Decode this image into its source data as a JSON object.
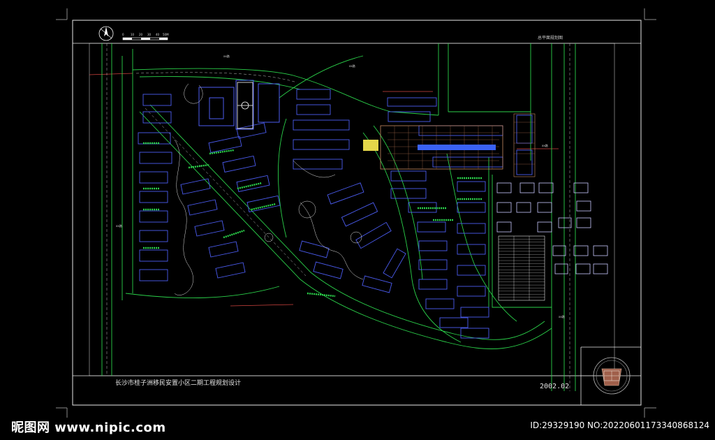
{
  "drawing": {
    "title_top": "总平面规划图",
    "title_bottom": "长沙市桂子洲移民安置小区二期工程规划设计",
    "date": "2002.02",
    "scale_ticks": [
      "0",
      "10",
      "20",
      "30",
      "40",
      "50M"
    ],
    "road_labels": [
      "xx路",
      "xx路",
      "xx路",
      "xx路",
      "xx路"
    ],
    "table_rows": [
      "",
      "",
      "",
      "",
      "",
      "",
      "",
      "",
      "",
      "",
      "",
      "",
      "",
      "",
      "",
      "",
      "",
      "",
      "",
      "",
      ""
    ],
    "colors": {
      "background": "#000000",
      "road": "#2bd14a",
      "building": "#4b5cf0",
      "boundary": "#ffffff",
      "accent_red": "#d0443f",
      "plaza": "#c98b63",
      "blue_strip": "#3a62f4"
    }
  },
  "watermark": {
    "site": "昵图网 www.nipic.com",
    "id_text": "ID:29329190 NO:20220601173340868124"
  }
}
